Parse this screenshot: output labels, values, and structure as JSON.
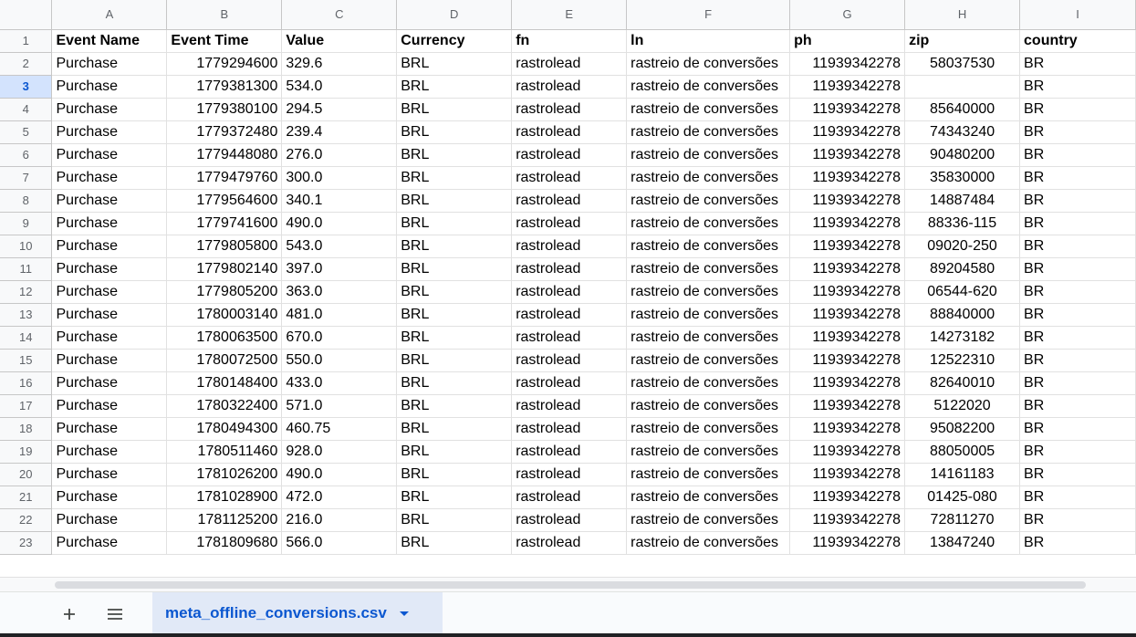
{
  "columns": [
    "A",
    "B",
    "C",
    "D",
    "E",
    "F",
    "G",
    "H",
    "I"
  ],
  "selected_row": 3,
  "header_row": {
    "number": "1",
    "cells": [
      "Event Name",
      "Event Time",
      "Value",
      "Currency",
      "fn",
      "ln",
      "ph",
      "zip",
      "country"
    ]
  },
  "rows": [
    {
      "num": "2",
      "cells": [
        "Purchase",
        "1779294600",
        "329.6",
        "BRL",
        "rastrolead",
        "rastreio de conversões",
        "11939342278",
        "58037530",
        "BR"
      ]
    },
    {
      "num": "3",
      "cells": [
        "Purchase",
        "1779381300",
        "534.0",
        "BRL",
        "rastrolead",
        "rastreio de conversões",
        "11939342278",
        "",
        "BR"
      ]
    },
    {
      "num": "4",
      "cells": [
        "Purchase",
        "1779380100",
        "294.5",
        "BRL",
        "rastrolead",
        "rastreio de conversões",
        "11939342278",
        "85640000",
        "BR"
      ]
    },
    {
      "num": "5",
      "cells": [
        "Purchase",
        "1779372480",
        "239.4",
        "BRL",
        "rastrolead",
        "rastreio de conversões",
        "11939342278",
        "74343240",
        "BR"
      ]
    },
    {
      "num": "6",
      "cells": [
        "Purchase",
        "1779448080",
        "276.0",
        "BRL",
        "rastrolead",
        "rastreio de conversões",
        "11939342278",
        "90480200",
        "BR"
      ]
    },
    {
      "num": "7",
      "cells": [
        "Purchase",
        "1779479760",
        "300.0",
        "BRL",
        "rastrolead",
        "rastreio de conversões",
        "11939342278",
        "35830000",
        "BR"
      ]
    },
    {
      "num": "8",
      "cells": [
        "Purchase",
        "1779564600",
        "340.1",
        "BRL",
        "rastrolead",
        "rastreio de conversões",
        "11939342278",
        "14887484",
        "BR"
      ]
    },
    {
      "num": "9",
      "cells": [
        "Purchase",
        "1779741600",
        "490.0",
        "BRL",
        "rastrolead",
        "rastreio de conversões",
        "11939342278",
        "88336-115",
        "BR"
      ]
    },
    {
      "num": "10",
      "cells": [
        "Purchase",
        "1779805800",
        "543.0",
        "BRL",
        "rastrolead",
        "rastreio de conversões",
        "11939342278",
        "09020-250",
        "BR"
      ]
    },
    {
      "num": "11",
      "cells": [
        "Purchase",
        "1779802140",
        "397.0",
        "BRL",
        "rastrolead",
        "rastreio de conversões",
        "11939342278",
        "89204580",
        "BR"
      ]
    },
    {
      "num": "12",
      "cells": [
        "Purchase",
        "1779805200",
        "363.0",
        "BRL",
        "rastrolead",
        "rastreio de conversões",
        "11939342278",
        "06544-620",
        "BR"
      ]
    },
    {
      "num": "13",
      "cells": [
        "Purchase",
        "1780003140",
        "481.0",
        "BRL",
        "rastrolead",
        "rastreio de conversões",
        "11939342278",
        "88840000",
        "BR"
      ]
    },
    {
      "num": "14",
      "cells": [
        "Purchase",
        "1780063500",
        "670.0",
        "BRL",
        "rastrolead",
        "rastreio de conversões",
        "11939342278",
        "14273182",
        "BR"
      ]
    },
    {
      "num": "15",
      "cells": [
        "Purchase",
        "1780072500",
        "550.0",
        "BRL",
        "rastrolead",
        "rastreio de conversões",
        "11939342278",
        "12522310",
        "BR"
      ]
    },
    {
      "num": "16",
      "cells": [
        "Purchase",
        "1780148400",
        "433.0",
        "BRL",
        "rastrolead",
        "rastreio de conversões",
        "11939342278",
        "82640010",
        "BR"
      ]
    },
    {
      "num": "17",
      "cells": [
        "Purchase",
        "1780322400",
        "571.0",
        "BRL",
        "rastrolead",
        "rastreio de conversões",
        "11939342278",
        "5122020",
        "BR"
      ]
    },
    {
      "num": "18",
      "cells": [
        "Purchase",
        "1780494300",
        "460.75",
        "BRL",
        "rastrolead",
        "rastreio de conversões",
        "11939342278",
        "95082200",
        "BR"
      ]
    },
    {
      "num": "19",
      "cells": [
        "Purchase",
        "1780511460",
        "928.0",
        "BRL",
        "rastrolead",
        "rastreio de conversões",
        "11939342278",
        "88050005",
        "BR"
      ]
    },
    {
      "num": "20",
      "cells": [
        "Purchase",
        "1781026200",
        "490.0",
        "BRL",
        "rastrolead",
        "rastreio de conversões",
        "11939342278",
        "14161183",
        "BR"
      ]
    },
    {
      "num": "21",
      "cells": [
        "Purchase",
        "1781028900",
        "472.0",
        "BRL",
        "rastrolead",
        "rastreio de conversões",
        "11939342278",
        "01425-080",
        "BR"
      ]
    },
    {
      "num": "22",
      "cells": [
        "Purchase",
        "1781125200",
        "216.0",
        "BRL",
        "rastrolead",
        "rastreio de conversões",
        "11939342278",
        "72811270",
        "BR"
      ]
    },
    {
      "num": "23",
      "cells": [
        "Purchase",
        "1781809680",
        "566.0",
        "BRL",
        "rastrolead",
        "rastreio de conversões",
        "11939342278",
        "13847240",
        "BR"
      ]
    }
  ],
  "sheet_tabs": {
    "add_icon": "plus-icon",
    "list_icon": "menu-list-icon",
    "active_tab": "meta_offline_conversions.csv",
    "caret_icon": "caret-down-icon"
  },
  "colors": {
    "accent": "#0b57d0",
    "tab_bg": "#e1e9f7",
    "selected_row_header": "#d3e3fd",
    "grid_line": "#e1e1e1",
    "header_bg": "#f8f9fa"
  }
}
